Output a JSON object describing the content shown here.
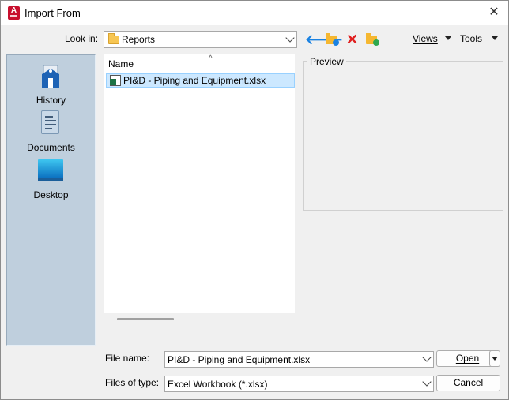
{
  "window": {
    "title": "Import From",
    "app_icon_letter": "A"
  },
  "toolbar": {
    "look_in_label": "Look in:",
    "look_in_value": "Reports",
    "views_label": "Views",
    "tools_label": "Tools",
    "icons": [
      "back-arrow-icon",
      "up-folder-icon",
      "delete-icon",
      "new-folder-icon"
    ]
  },
  "places": [
    {
      "label": "History",
      "icon": "history-icon"
    },
    {
      "label": "Documents",
      "icon": "documents-icon"
    },
    {
      "label": "Desktop",
      "icon": "desktop-icon"
    }
  ],
  "file_list": {
    "column_header": "Name",
    "files": [
      {
        "name": "PI&D - Piping and Equipment.xlsx",
        "icon": "excel-file-icon",
        "selected": true
      }
    ]
  },
  "preview": {
    "label": "Preview"
  },
  "footer": {
    "file_name_label": "File name:",
    "file_name_value": "PI&D - Piping and Equipment.xlsx",
    "files_of_type_label": "Files of type:",
    "files_of_type_value": "Excel Workbook (*.xlsx)",
    "open_label": "Open",
    "cancel_label": "Cancel"
  },
  "colors": {
    "selection": "#cce8ff",
    "places_bg": "#bfcfdd",
    "back_arrow": "#1a82e2",
    "delete": "#e02020",
    "app_icon": "#c8102e"
  }
}
